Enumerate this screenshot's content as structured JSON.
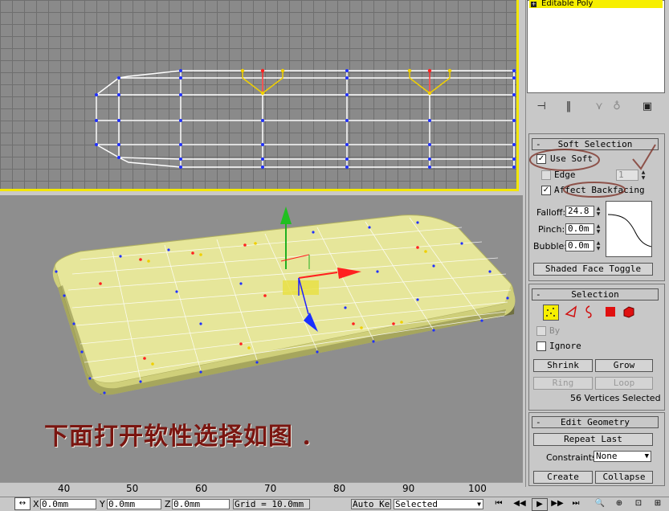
{
  "modifier_stack": {
    "item_label": "Editable Poly"
  },
  "soft_selection": {
    "title": "Soft Selection",
    "use_soft_label": "Use Soft",
    "use_soft_checked": true,
    "edge_label": "Edge",
    "edge_value": "1",
    "affect_backfacing_label": "Affect Backfacing",
    "affect_backfacing_checked": true,
    "falloff_label": "Falloff:",
    "falloff_value": "24.8",
    "pinch_label": "Pinch:",
    "pinch_value": "0.0m",
    "bubble_label": "Bubble:",
    "bubble_value": "0.0m",
    "shaded_face_toggle_label": "Shaded Face Toggle"
  },
  "selection": {
    "title": "Selection",
    "by_label": "By",
    "ignore_label": "Ignore",
    "shrink_label": "Shrink",
    "grow_label": "Grow",
    "ring_label": "Ring",
    "loop_label": "Loop",
    "status": "56 Vertices Selected"
  },
  "edit_geometry": {
    "title": "Edit Geometry",
    "repeat_last_label": "Repeat Last",
    "constraints_label": "Constraints:",
    "constraints_value": "None",
    "create_label": "Create",
    "collapse_label": "Collapse"
  },
  "caption": "下面打开软性选择如图 .",
  "ruler": {
    "ticks": [
      "40",
      "50",
      "60",
      "70",
      "80",
      "90",
      "100"
    ]
  },
  "status_bar": {
    "x_label": "X",
    "x_value": "0.0mm",
    "y_label": "Y",
    "y_value": "0.0mm",
    "z_label": "Z",
    "z_value": "0.0mm",
    "grid_label": "Grid = 10.0mm",
    "auto_key_label": "Auto Key",
    "selected_value": "Selected"
  },
  "colors": {
    "viewport_active_border": "#f2e600",
    "selected_vertex": "#ff2020",
    "soft_vertex": "#f0d000",
    "mesh_fill": "#e8e89a",
    "caption_text": "#7a1510"
  }
}
